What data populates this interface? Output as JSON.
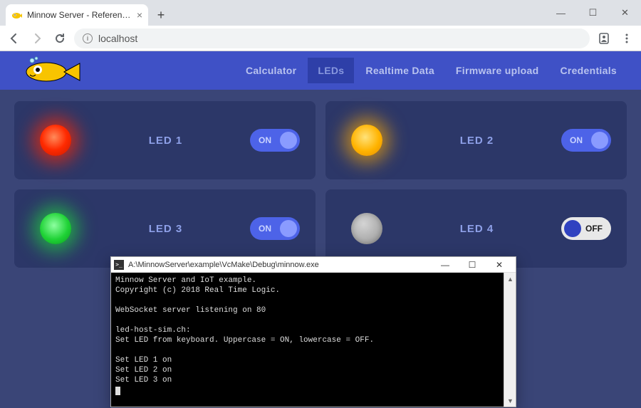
{
  "browser": {
    "tab_title": "Minnow Server - Reference Platf",
    "url": "localhost"
  },
  "nav": {
    "items": [
      "Calculator",
      "LEDs",
      "Realtime Data",
      "Firmware upload",
      "Credentials"
    ],
    "active_index": 1
  },
  "leds": [
    {
      "label": "LED 1",
      "color": "red",
      "on": true,
      "toggle_text": "ON"
    },
    {
      "label": "LED 2",
      "color": "orange",
      "on": true,
      "toggle_text": "ON"
    },
    {
      "label": "LED 3",
      "color": "green",
      "on": true,
      "toggle_text": "ON"
    },
    {
      "label": "LED 4",
      "color": "off",
      "on": false,
      "toggle_text": "OFF"
    }
  ],
  "terminal": {
    "title": "A:\\MinnowServer\\example\\VcMake\\Debug\\minnow.exe",
    "lines": [
      "Minnow Server and IoT example.",
      "Copyright (c) 2018 Real Time Logic.",
      "",
      "WebSocket server listening on 80",
      "",
      "led-host-sim.ch:",
      "Set LED from keyboard. Uppercase = ON, lowercase = OFF.",
      "",
      "Set LED 1 on",
      "Set LED 2 on",
      "Set LED 3 on"
    ]
  }
}
